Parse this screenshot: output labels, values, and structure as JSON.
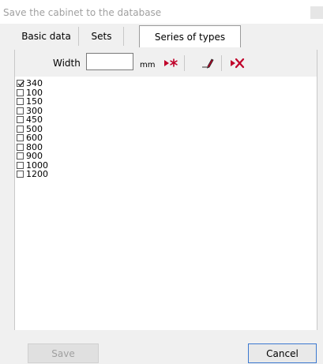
{
  "window": {
    "title": "Save the cabinet to the database"
  },
  "tabs": [
    {
      "label": "Basic data"
    },
    {
      "label": "Sets"
    },
    {
      "label": "Series of types",
      "active": true
    }
  ],
  "toolbar": {
    "width_label": "Width",
    "width_value": "",
    "unit": "mm",
    "add_icon": "add-star-icon",
    "edit_icon": "pencil-icon",
    "delete_icon": "delete-x-icon"
  },
  "list": {
    "items": [
      {
        "label": "340",
        "checked": true
      },
      {
        "label": "100",
        "checked": false
      },
      {
        "label": "150",
        "checked": false
      },
      {
        "label": "300",
        "checked": false
      },
      {
        "label": "450",
        "checked": false
      },
      {
        "label": "500",
        "checked": false
      },
      {
        "label": "600",
        "checked": false
      },
      {
        "label": "800",
        "checked": false
      },
      {
        "label": "900",
        "checked": false
      },
      {
        "label": "1000",
        "checked": false
      },
      {
        "label": "1200",
        "checked": false
      }
    ]
  },
  "footer": {
    "save_label": "Save",
    "cancel_label": "Cancel"
  },
  "colors": {
    "icon_red": "#c0002a",
    "accent_blue": "#3b78d0"
  }
}
